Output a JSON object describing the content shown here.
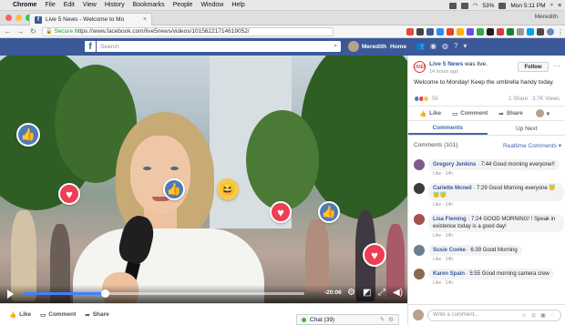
{
  "menubar": {
    "app": "Chrome",
    "items": [
      "File",
      "Edit",
      "View",
      "History",
      "Bookmarks",
      "People",
      "Window",
      "Help"
    ],
    "battery": "53%",
    "clock": "Mon 5:11 PM"
  },
  "tab": {
    "title": "Live 5 News - Welcome to Mo"
  },
  "browser_user": "Meredith",
  "address": {
    "secure": "Secure",
    "url": "https://www.facebook.com/live5news/videos/10156221714619052/"
  },
  "fb": {
    "logo": "f",
    "search_placeholder": "Search",
    "user": "Meredith",
    "home": "Home"
  },
  "video": {
    "time": "-20:06",
    "progress": 0.29
  },
  "video_actions": {
    "like": "Like",
    "comment": "Comment",
    "share": "Share"
  },
  "chat": {
    "label": "Chat (39)"
  },
  "post": {
    "page": "Live 5 News",
    "suffix": " was live.",
    "time": "14 hours ago",
    "follow": "Follow",
    "text": "Welcome to Monday! Keep the umbrella handy today.",
    "reactions": "55",
    "shares": "1 Share",
    "views": "3.7K Views",
    "like": "Like",
    "comment": "Comment",
    "share": "Share"
  },
  "tabs": {
    "comments": "Comments",
    "upnext": "Up Next"
  },
  "comments_header": {
    "count": "Comments (101)",
    "sort": "Realtime Comments ▾"
  },
  "comments": [
    {
      "name": "Gregory Jenkins",
      "meta": " · 7:44 ",
      "text": "Good morning everyone!!",
      "actions": "Like · 14h",
      "color": "#7b5b8a"
    },
    {
      "name": "Carlette Mcneil",
      "meta": " · 7:29 ",
      "text": "Good Morning everyone 😇😇😇",
      "actions": "Like · 14h",
      "color": "#3d3b3a"
    },
    {
      "name": "Lisa Fleming",
      "meta": " · 7:24 ",
      "text": "GOOD MORNING! ! Speak in existence today is a good day!",
      "actions": "Like · 14h",
      "color": "#a0524b"
    },
    {
      "name": "Susie Cooke",
      "meta": " · 6:39 ",
      "text": "Good Morning",
      "actions": "Like · 14h",
      "color": "#6c7f8f"
    },
    {
      "name": "Karen Spain",
      "meta": " · 5:55 ",
      "text": "Good morning camera crew",
      "actions": "Like · 14h",
      "color": "#8a6a4e"
    }
  ],
  "write_comment": "Write a comment...",
  "icons": {
    "like": "thumbs-up-icon",
    "love": "heart-icon",
    "haha": "laugh-icon"
  },
  "colors": {
    "fb_blue": "#3b5998",
    "link": "#365899",
    "accent": "#4267b2",
    "love": "#ec3e55",
    "like": "#4f79bd"
  }
}
